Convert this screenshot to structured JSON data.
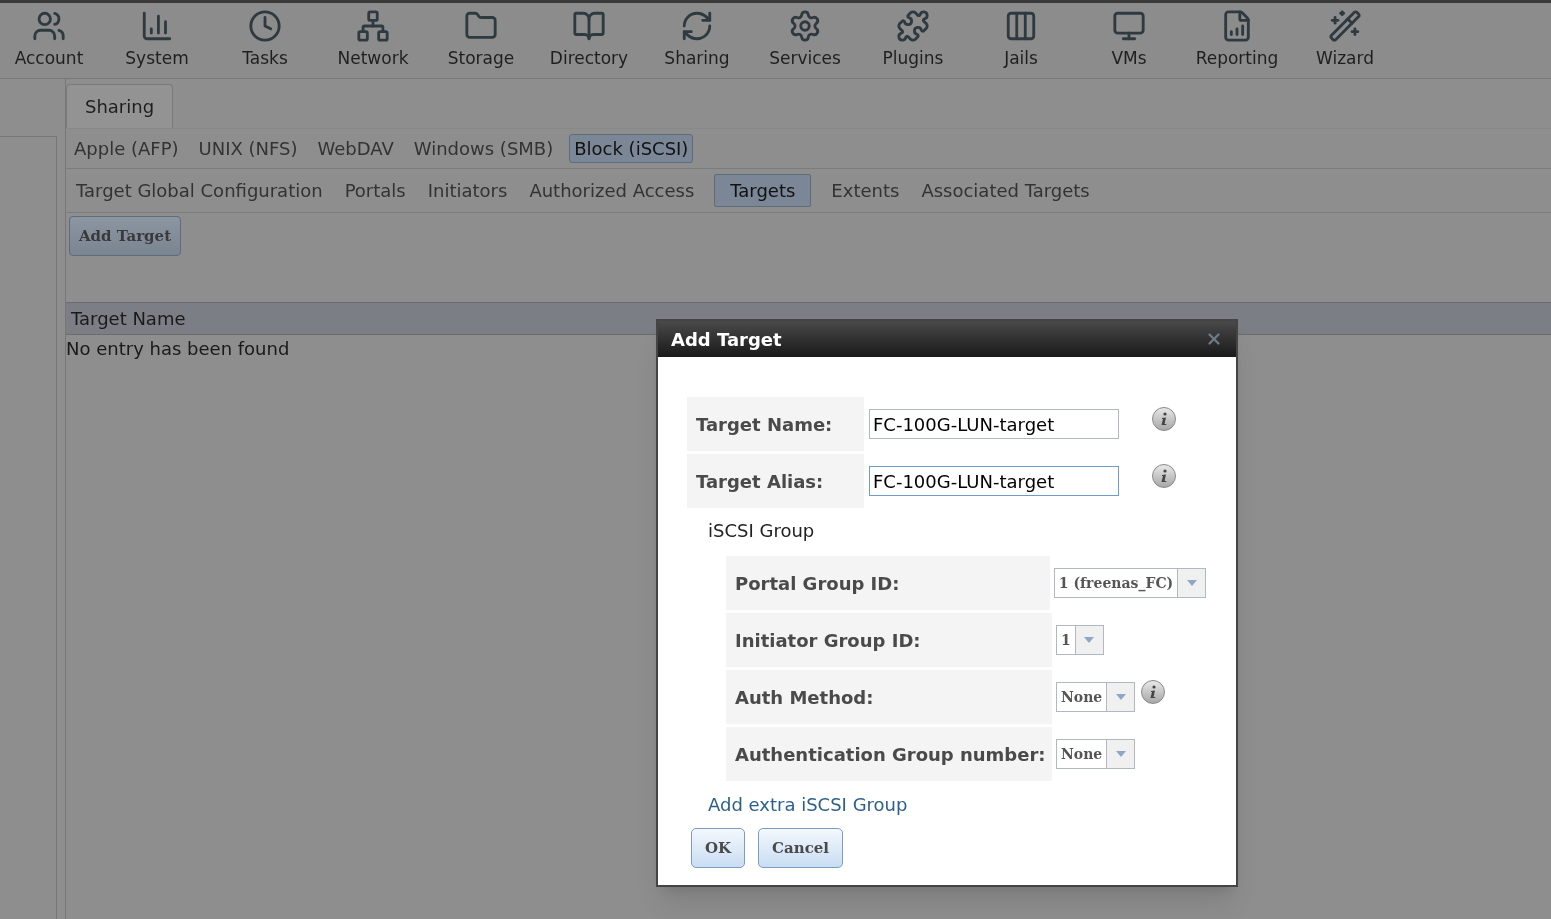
{
  "nav": [
    {
      "label": "Account"
    },
    {
      "label": "System"
    },
    {
      "label": "Tasks"
    },
    {
      "label": "Network"
    },
    {
      "label": "Storage"
    },
    {
      "label": "Directory"
    },
    {
      "label": "Sharing"
    },
    {
      "label": "Services"
    },
    {
      "label": "Plugins"
    },
    {
      "label": "Jails"
    },
    {
      "label": "VMs"
    },
    {
      "label": "Reporting"
    },
    {
      "label": "Wizard"
    }
  ],
  "page_tabs": [
    {
      "label": "Sharing",
      "selected": true
    }
  ],
  "share_tabs": [
    {
      "label": "Apple (AFP)",
      "selected": false
    },
    {
      "label": "UNIX (NFS)",
      "selected": false
    },
    {
      "label": "WebDAV",
      "selected": false
    },
    {
      "label": "Windows (SMB)",
      "selected": false
    },
    {
      "label": "Block (iSCSI)",
      "selected": true
    }
  ],
  "sub_tabs": [
    {
      "label": "Target Global Configuration",
      "selected": false
    },
    {
      "label": "Portals",
      "selected": false
    },
    {
      "label": "Initiators",
      "selected": false
    },
    {
      "label": "Authorized Access",
      "selected": false
    },
    {
      "label": "Targets",
      "selected": true
    },
    {
      "label": "Extents",
      "selected": false
    },
    {
      "label": "Associated Targets",
      "selected": false
    }
  ],
  "add_button": "Add Target",
  "table": {
    "columns": [
      "Target Name"
    ],
    "empty_message": "No entry has been found"
  },
  "dialog": {
    "title": "Add Target",
    "fields": [
      {
        "label": "Target Name:",
        "value": "FC-100G-LUN-target",
        "focused": false,
        "info": true
      },
      {
        "label": "Target Alias:",
        "value": "FC-100G-LUN-target",
        "focused": true,
        "info": true
      }
    ],
    "group_heading": "iSCSI Group",
    "group_fields": [
      {
        "label": "Portal Group ID:",
        "value": "1 (freenas_FC)",
        "info": false
      },
      {
        "label": "Initiator Group ID:",
        "value": "1",
        "info": false
      },
      {
        "label": "Auth Method:",
        "value": "None",
        "info": true
      },
      {
        "label": "Authentication Group number:",
        "value": "None",
        "info": false
      }
    ],
    "add_link": "Add extra iSCSI Group",
    "buttons": [
      "OK",
      "Cancel"
    ]
  }
}
